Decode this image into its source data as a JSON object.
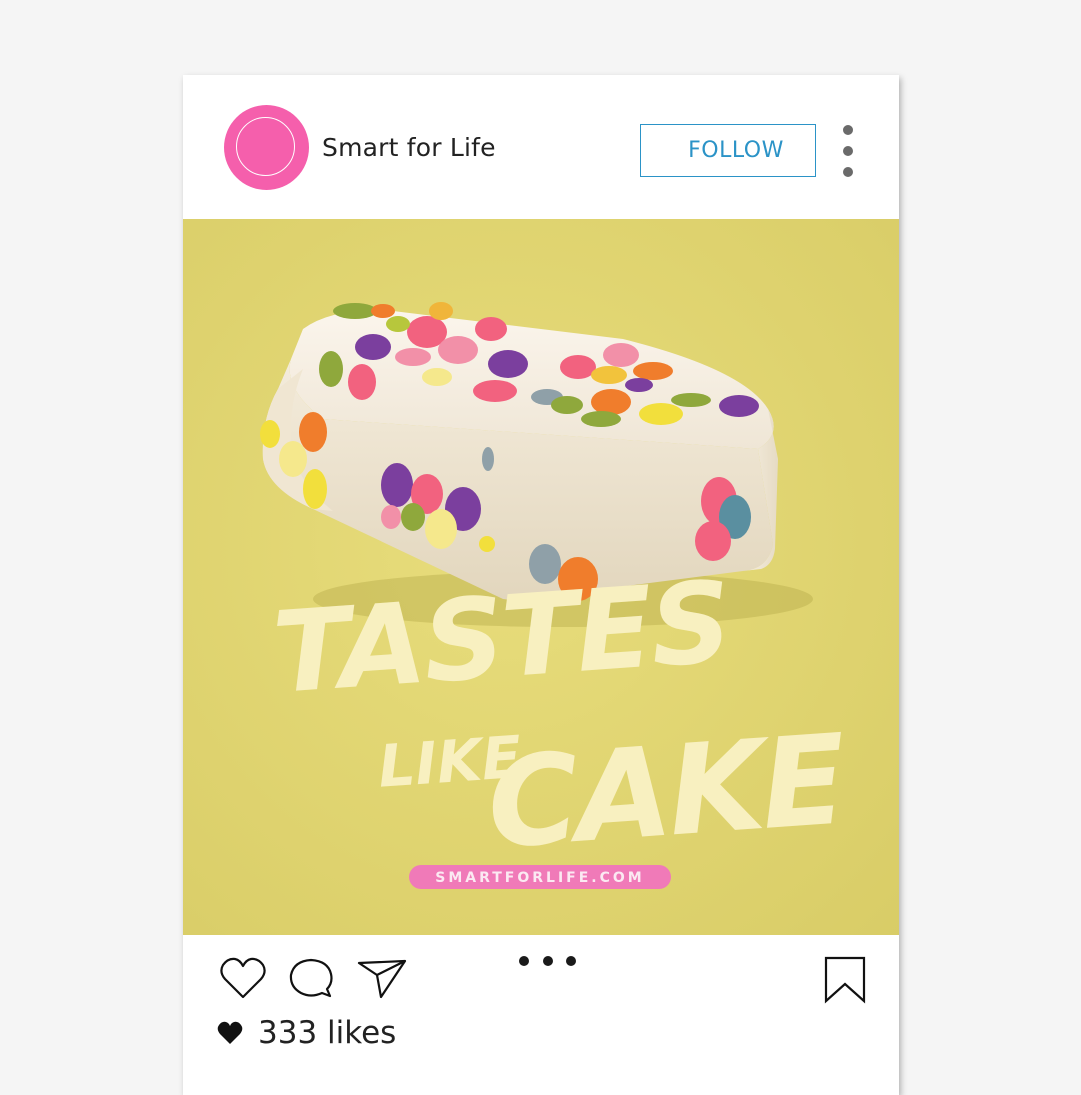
{
  "post": {
    "account_name": "Smart for Life",
    "follow_label": "FOLLOW",
    "image": {
      "headline_line1": "TASTES",
      "headline_line2_small": "LIKE",
      "headline_line2_large": "CAKE",
      "url_pill": "SMARTFORLIFE.COM"
    },
    "likes_count": "333",
    "likes_label": "likes"
  },
  "icons": {
    "like": "heart-outline-icon",
    "comment": "comment-bubble-icon",
    "share": "paper-plane-icon",
    "bookmark": "bookmark-icon",
    "more": "vertical-ellipsis-icon",
    "likes_heart": "heart-filled-icon"
  },
  "colors": {
    "avatar": "#f55fac",
    "follow_accent": "#2b93c7",
    "image_background": "#e3d774",
    "headline": "#f8f0c0",
    "url_pill": "#f07ab8"
  },
  "carousel": {
    "pages": 3
  }
}
